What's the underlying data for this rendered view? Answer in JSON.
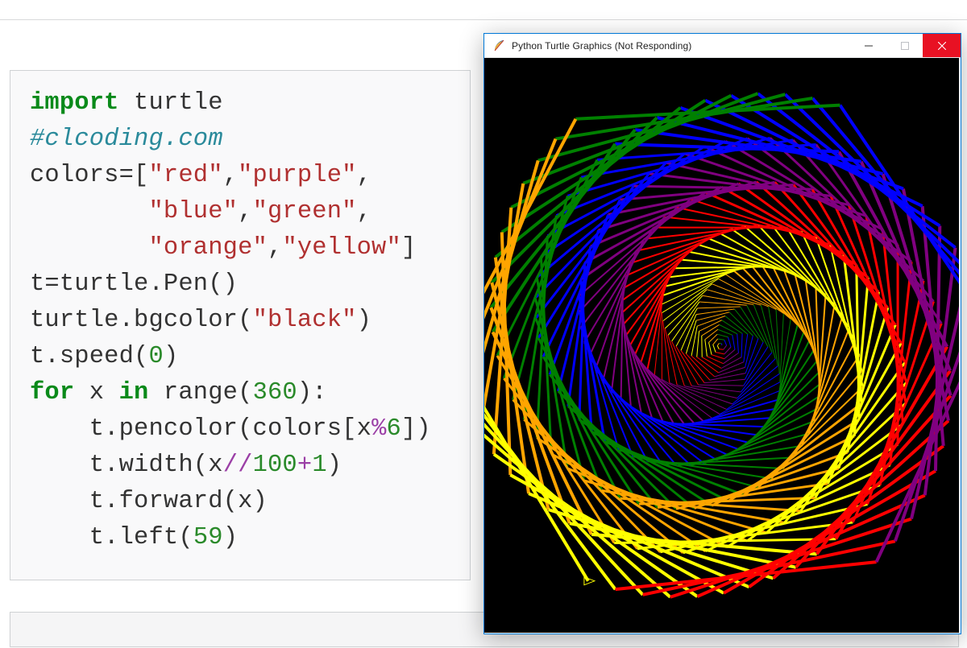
{
  "window": {
    "title": "Python Turtle Graphics (Not Responding)",
    "minimize_label": "Minimize",
    "maximize_label": "Maximize",
    "close_label": "Close"
  },
  "code": {
    "line1_kw": "import",
    "line1_rest": " turtle",
    "line2_comment": "#clcoding.com",
    "line3a": "colors=[",
    "line3_s1": "\"red\"",
    "line3_c1": ",",
    "line3_s2": "\"purple\"",
    "line3_c2": ",",
    "line4_ind": "        ",
    "line4_s1": "\"blue\"",
    "line4_c1": ",",
    "line4_s2": "\"green\"",
    "line4_c2": ",",
    "line5_ind": "        ",
    "line5_s1": "\"orange\"",
    "line5_c1": ",",
    "line5_s2": "\"yellow\"",
    "line5_close": "]",
    "line6": "t=turtle.Pen()",
    "line7a": "turtle.bgcolor(",
    "line7_s": "\"black\"",
    "line7b": ")",
    "line8a": "t.speed(",
    "line8_n": "0",
    "line8b": ")",
    "line9_for": "for",
    "line9_mid": " x ",
    "line9_in": "in",
    "line9_range": " range(",
    "line9_n": "360",
    "line9_end": "):",
    "line10_ind": "    ",
    "line10a": "t.pencolor(colors[x",
    "line10_op": "%",
    "line10_n": "6",
    "line10b": "])",
    "line11_ind": "    ",
    "line11a": "t.width(x",
    "line11_op": "//",
    "line11_n1": "100",
    "line11_plus": "+",
    "line11_n2": "1",
    "line11b": ")",
    "line12_ind": "    ",
    "line12": "t.forward(x)",
    "line13_ind": "    ",
    "line13a": "t.left(",
    "line13_n": "59",
    "line13b": ")"
  },
  "turtle_program": {
    "colors": [
      "red",
      "purple",
      "blue",
      "green",
      "orange",
      "yellow"
    ],
    "bgcolor": "black",
    "speed": 0,
    "iterations": 360,
    "angle_deg": 59,
    "width_formula": "x//100 + 1",
    "color_formula": "colors[x % 6]",
    "step_formula": "forward(x)"
  }
}
